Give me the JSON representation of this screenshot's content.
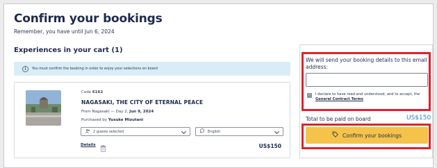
{
  "header": {
    "title": "Confirm your bookings",
    "subtitle": "Remember, you have until Jun 6, 2024"
  },
  "cart": {
    "heading": "Experiences in your cart (1)",
    "info_message": "You must confirm the booking in order to enjoy your selections on board",
    "item": {
      "code_label": "Code",
      "code_value": "6162",
      "title": "NAGASAKI, THE CITY OF ETERNAL PEACE",
      "from_text": "From Nagasaki — Day 2,",
      "date": "Jun 9, 2024",
      "purchased_label": "Purchased by",
      "purchaser": "Yusuke Mizutani",
      "guests_select": "2 guests selected",
      "language_select": "English",
      "details_link": "Details",
      "price": "US$150"
    }
  },
  "booking_panel": {
    "email_prompt": "We will send your booking details to this email address:",
    "email_value": "",
    "declare_text": "I declare to have read and understood, and to accept, the",
    "terms_link": "General Contract Terms",
    "terms_checked": true,
    "total_label": "Total to be paid on board",
    "total_value": "US$150",
    "confirm_button": "Confirm your bookings"
  },
  "colors": {
    "accent_button": "#f5c34a",
    "price_blue": "#2d7fd9",
    "highlight_red": "#e4202a",
    "info_bg": "#d9edf7"
  }
}
